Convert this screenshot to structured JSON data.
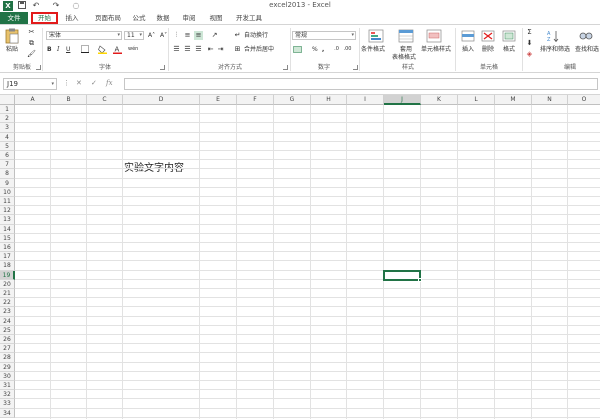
{
  "window": {
    "title": "excel2013 - Excel",
    "app_icon": "X",
    "undo_icon": "↶",
    "redo_icon": "↷",
    "more_icon": "◌"
  },
  "tabs": [
    "文件",
    "开始",
    "插入",
    "页面布局",
    "公式",
    "数据",
    "审阅",
    "视图",
    "开发工具"
  ],
  "accent_color": "#217346",
  "highlight_color": "#e21b1b",
  "ribbon": {
    "clipboard": {
      "paste": "粘贴",
      "label": "剪贴板"
    },
    "font": {
      "name": "宋体",
      "size": "11",
      "grow": "A˄",
      "shrink": "A˅",
      "bold": "B",
      "italic": "I",
      "underline": "U",
      "wen": "wén",
      "label": "字体"
    },
    "alignment": {
      "wrap": "自动换行",
      "merge": "合并后居中",
      "label": "对齐方式"
    },
    "number": {
      "format": "常规",
      "percent": "%",
      "comma": ",",
      "label": "数字"
    },
    "styles": {
      "conditional": "条件格式",
      "table": "套用\n表格格式",
      "table_line1": "套用",
      "table_line2": "表格格式",
      "cell": "单元格样式",
      "label": "样式"
    },
    "cells": {
      "insert": "插入",
      "delete": "删除",
      "format": "格式",
      "label": "单元格"
    },
    "editing": {
      "sort": "排序和筛选",
      "find": "查找和选",
      "label": "编辑"
    }
  },
  "formula_bar": {
    "name_box": "J19",
    "cancel": "✕",
    "enter": "✓",
    "fx": "fx",
    "value": ""
  },
  "sheet": {
    "columns": [
      "A",
      "B",
      "C",
      "D",
      "E",
      "F",
      "G",
      "H",
      "I",
      "J",
      "K",
      "L",
      "M",
      "N",
      "O"
    ],
    "rows": [
      "1",
      "2",
      "3",
      "4",
      "5",
      "6",
      "7",
      "8",
      "9",
      "10",
      "11",
      "12",
      "13",
      "14",
      "15",
      "16",
      "17",
      "18",
      "19",
      "20",
      "21",
      "22",
      "23",
      "24",
      "25",
      "26",
      "27",
      "28",
      "29",
      "30",
      "31",
      "32",
      "33",
      "34"
    ],
    "selected_cell": "J19",
    "cell_D7": "实验文字内容"
  }
}
